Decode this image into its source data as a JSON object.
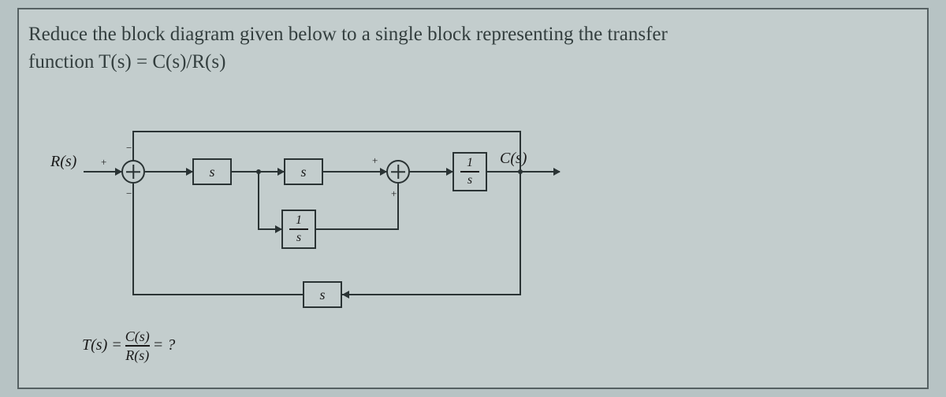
{
  "prompt_line1": "Reduce the block diagram given below to a single block representing the transfer",
  "prompt_line2": "function T(s) = C(s)/R(s)",
  "signals": {
    "input": "R(s)",
    "output": "C(s)"
  },
  "blocks": {
    "g1": "s",
    "g2": "s",
    "g3_num": "1",
    "g3_den": "s",
    "h1_num": "1",
    "h1_den": "s",
    "h2": "s"
  },
  "sum1": {
    "left": "+",
    "top": "−",
    "bottom": "−"
  },
  "sum2": {
    "left": "+",
    "bottom": "+"
  },
  "equation": {
    "lhs": "T(s) =",
    "frac_num": "C(s)",
    "frac_den": "R(s)",
    "rhs": "= ?"
  }
}
